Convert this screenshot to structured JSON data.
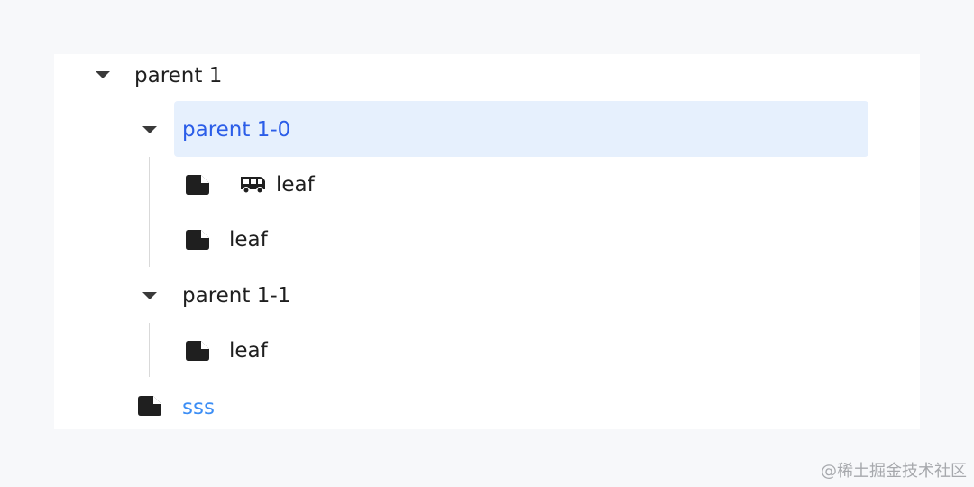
{
  "tree": {
    "nodes": [
      {
        "label": "parent 1",
        "level": 0,
        "expanded": true,
        "selected": false
      },
      {
        "label": "parent 1-0",
        "level": 1,
        "expanded": true,
        "selected": true
      },
      {
        "label": "leaf",
        "level": 2,
        "icon": "bus-icon"
      },
      {
        "label": "leaf",
        "level": 2
      },
      {
        "label": "parent 1-1",
        "level": 1,
        "expanded": true,
        "selected": false
      },
      {
        "label": "leaf",
        "level": 2
      },
      {
        "label": "sss",
        "level": 1,
        "link_style": true
      }
    ]
  },
  "colors": {
    "selected_background": "#e6f0fd",
    "selected_text": "#2b5de8",
    "link_text": "#3c8ef5",
    "text": "#1f1f1f",
    "page_background": "#f7f8fa"
  },
  "watermark": "@稀土掘金技术社区"
}
